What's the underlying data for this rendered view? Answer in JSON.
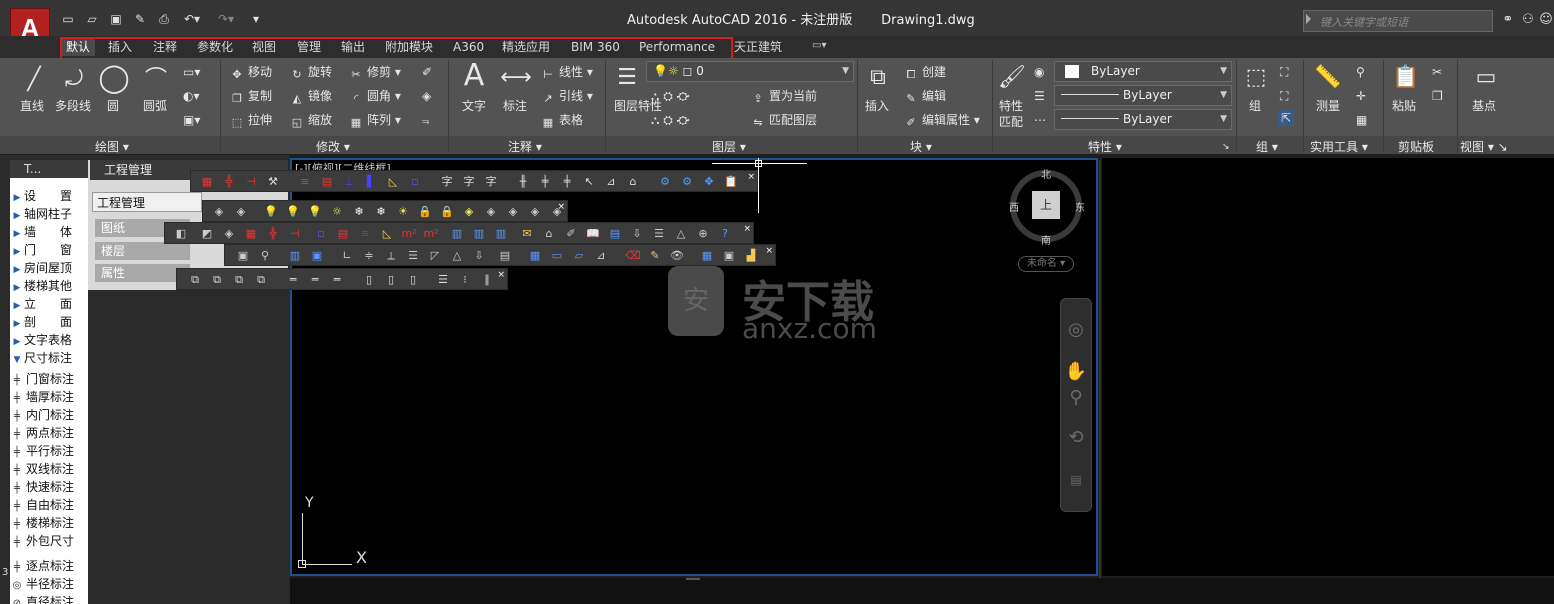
{
  "window": {
    "title": "Autodesk AutoCAD 2016 - 未注册版",
    "document": "Drawing1.dwg",
    "app_letter": "A",
    "search_placeholder": "键入关键字或短语"
  },
  "tabs": [
    "默认",
    "插入",
    "注释",
    "参数化",
    "视图",
    "管理",
    "输出",
    "附加模块",
    "A360",
    "精选应用",
    "BIM 360",
    "Performance",
    "天正建筑"
  ],
  "ribbon": {
    "draw": {
      "line": "直线",
      "polyline": "多段线",
      "circle": "圆",
      "arc": "圆弧",
      "panel": "绘图"
    },
    "modify": {
      "move": "移动",
      "rotate": "旋转",
      "trim": "修剪",
      "copy": "复制",
      "mirror": "镜像",
      "fillet": "圆角",
      "stretch": "拉伸",
      "scale": "缩放",
      "array": "阵列",
      "panel": "修改"
    },
    "annotation": {
      "text": "文字",
      "dim": "标注",
      "linear": "线性",
      "leader": "引线",
      "table": "表格",
      "panel": "注释"
    },
    "layers": {
      "props": "图层特性",
      "current_layer": "0",
      "set_current": "置为当前",
      "match": "匹配图层",
      "panel": "图层"
    },
    "block": {
      "insert": "插入",
      "create": "创建",
      "edit": "编辑",
      "edit_attr": "编辑属性",
      "panel": "块"
    },
    "properties": {
      "match": "特性匹配",
      "color": "ByLayer",
      "linetype": "ByLayer",
      "lineweight": "ByLayer",
      "panel": "特性"
    },
    "groups": {
      "group": "组",
      "panel": "组"
    },
    "utilities": {
      "measure": "测量",
      "panel": "实用工具"
    },
    "clipboard": {
      "paste": "粘贴",
      "panel": "剪贴板"
    },
    "view": {
      "base": "基点",
      "panel": "视图"
    }
  },
  "left_panel": {
    "header": "T...",
    "items": [
      "设　　置",
      "轴网柱子",
      "墙　　体",
      "门　　窗",
      "房间屋顶",
      "楼梯其他",
      "立　　面",
      "剖　　面",
      "文字表格",
      "尺寸标注"
    ],
    "sub_items": [
      "门窗标注",
      "墙厚标注",
      "内门标注",
      "两点标注",
      "平行标注",
      "双线标注",
      "快速标注",
      "自由标注",
      "楼梯标注",
      "外包尺寸"
    ],
    "sub_items2": [
      "逐点标注",
      "半径标注",
      "直径标注"
    ],
    "row_number": "3"
  },
  "project_manager": {
    "title": "工程管理",
    "dropdown": "工程管理",
    "items": [
      "图纸",
      "楼层",
      "属性"
    ]
  },
  "viewport": {
    "label": "[-][俯视][二维线框]",
    "compass": {
      "n": "北",
      "s": "南",
      "e": "东",
      "w": "西",
      "top": "上"
    },
    "ucs_name": "未命名",
    "axis_y": "Y",
    "axis_x": "X"
  },
  "watermark": {
    "brand": "安下载",
    "url": "anxz.com",
    "badge": "安"
  }
}
